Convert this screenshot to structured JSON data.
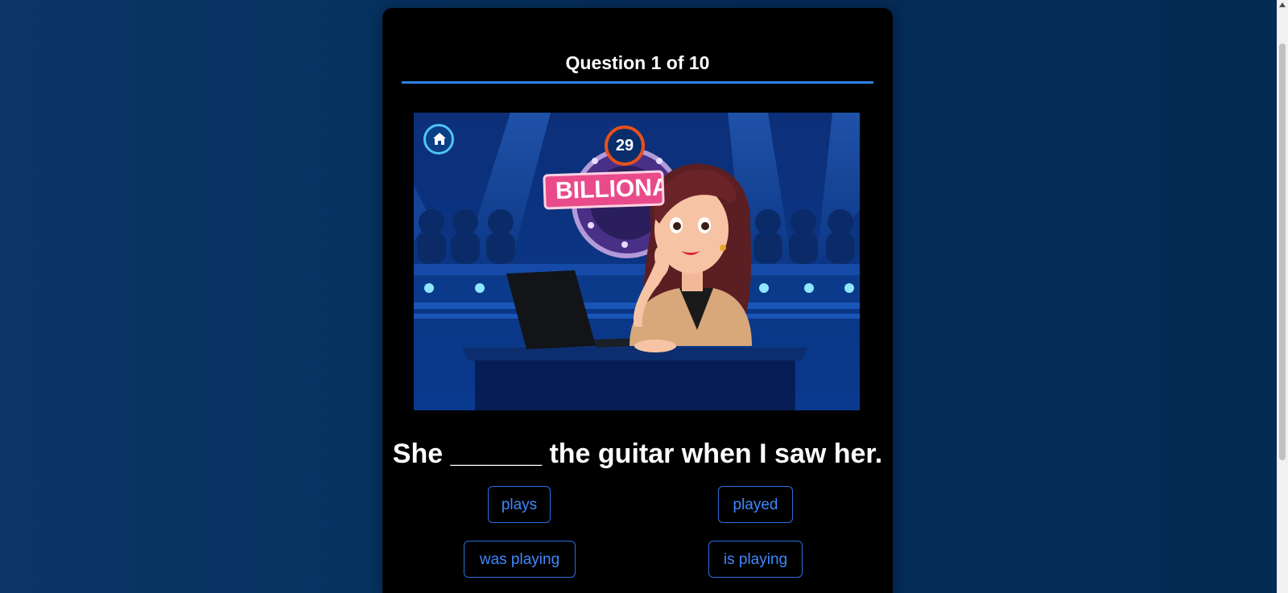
{
  "quiz": {
    "progress_label": "Question 1 of 10",
    "timer_value": "29",
    "banner_text": "BILLIONA",
    "question_text": "She ______ the guitar when I saw her.",
    "options": [
      {
        "label": "plays"
      },
      {
        "label": "played"
      },
      {
        "label": "was playing"
      },
      {
        "label": "is playing"
      }
    ]
  },
  "colors": {
    "page_background": "#063260",
    "card_background": "#000000",
    "accent_blue": "#2f7fe6",
    "option_text": "#3f88ff",
    "timer_ring": "#e8501c",
    "banner_pink": "#e94b8a"
  },
  "icons": {
    "home": "home-icon"
  }
}
